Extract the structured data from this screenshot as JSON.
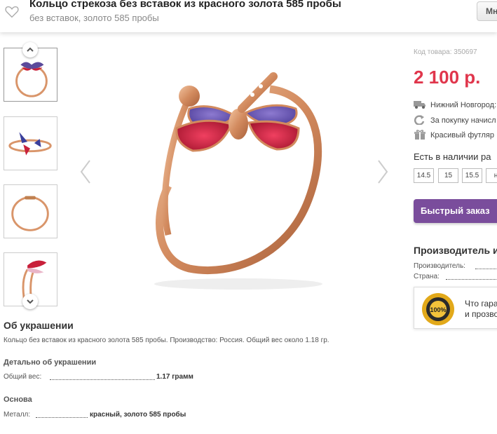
{
  "header": {
    "title": "Кольцо стрекоза без вставок из красного золота 585 пробы",
    "subtitle": "без вставок, золото 585 пробы",
    "button_label": "Мн"
  },
  "gallery": {
    "thumbnails": [
      "ring-front",
      "ring-top",
      "ring-side",
      "ring-angle"
    ],
    "active_index": 0
  },
  "product": {
    "sku": "Код товара: 350697",
    "price": "2 100 р.",
    "features": [
      {
        "icon": "truck-icon",
        "text": "Нижний Новгород:"
      },
      {
        "icon": "refresh-icon",
        "text": "За покупку начисл"
      },
      {
        "icon": "gift-icon",
        "text": "Красивый футляр"
      }
    ],
    "availability_title": "Есть в наличии ра",
    "sizes": [
      "14.5",
      "15",
      "15.5",
      "н"
    ],
    "quick_order_label": "Быстрый заказ"
  },
  "manufacturer": {
    "title": "Производитель и",
    "rows": [
      {
        "label": "Производитель:"
      },
      {
        "label": "Страна:"
      }
    ],
    "guarantee_line1": "Что гара",
    "guarantee_line2": "и прозво",
    "seal_text": "100%"
  },
  "about": {
    "heading": "Об украшении",
    "description": "Кольцо без вставок из красного золота 585 пробы. Производство: Россия. Общий вес около 1.18 гр.",
    "detail_heading": "Детально об украшении",
    "weight_label": "Общий вес:",
    "weight_value": "1.17 грамм",
    "base_heading": "Основа",
    "metal_label": "Металл:",
    "metal_value": "красный, золото 585 пробы"
  },
  "colors": {
    "price": "#e0364c",
    "button": "#7a4d9c",
    "gold": "#d9956a"
  }
}
